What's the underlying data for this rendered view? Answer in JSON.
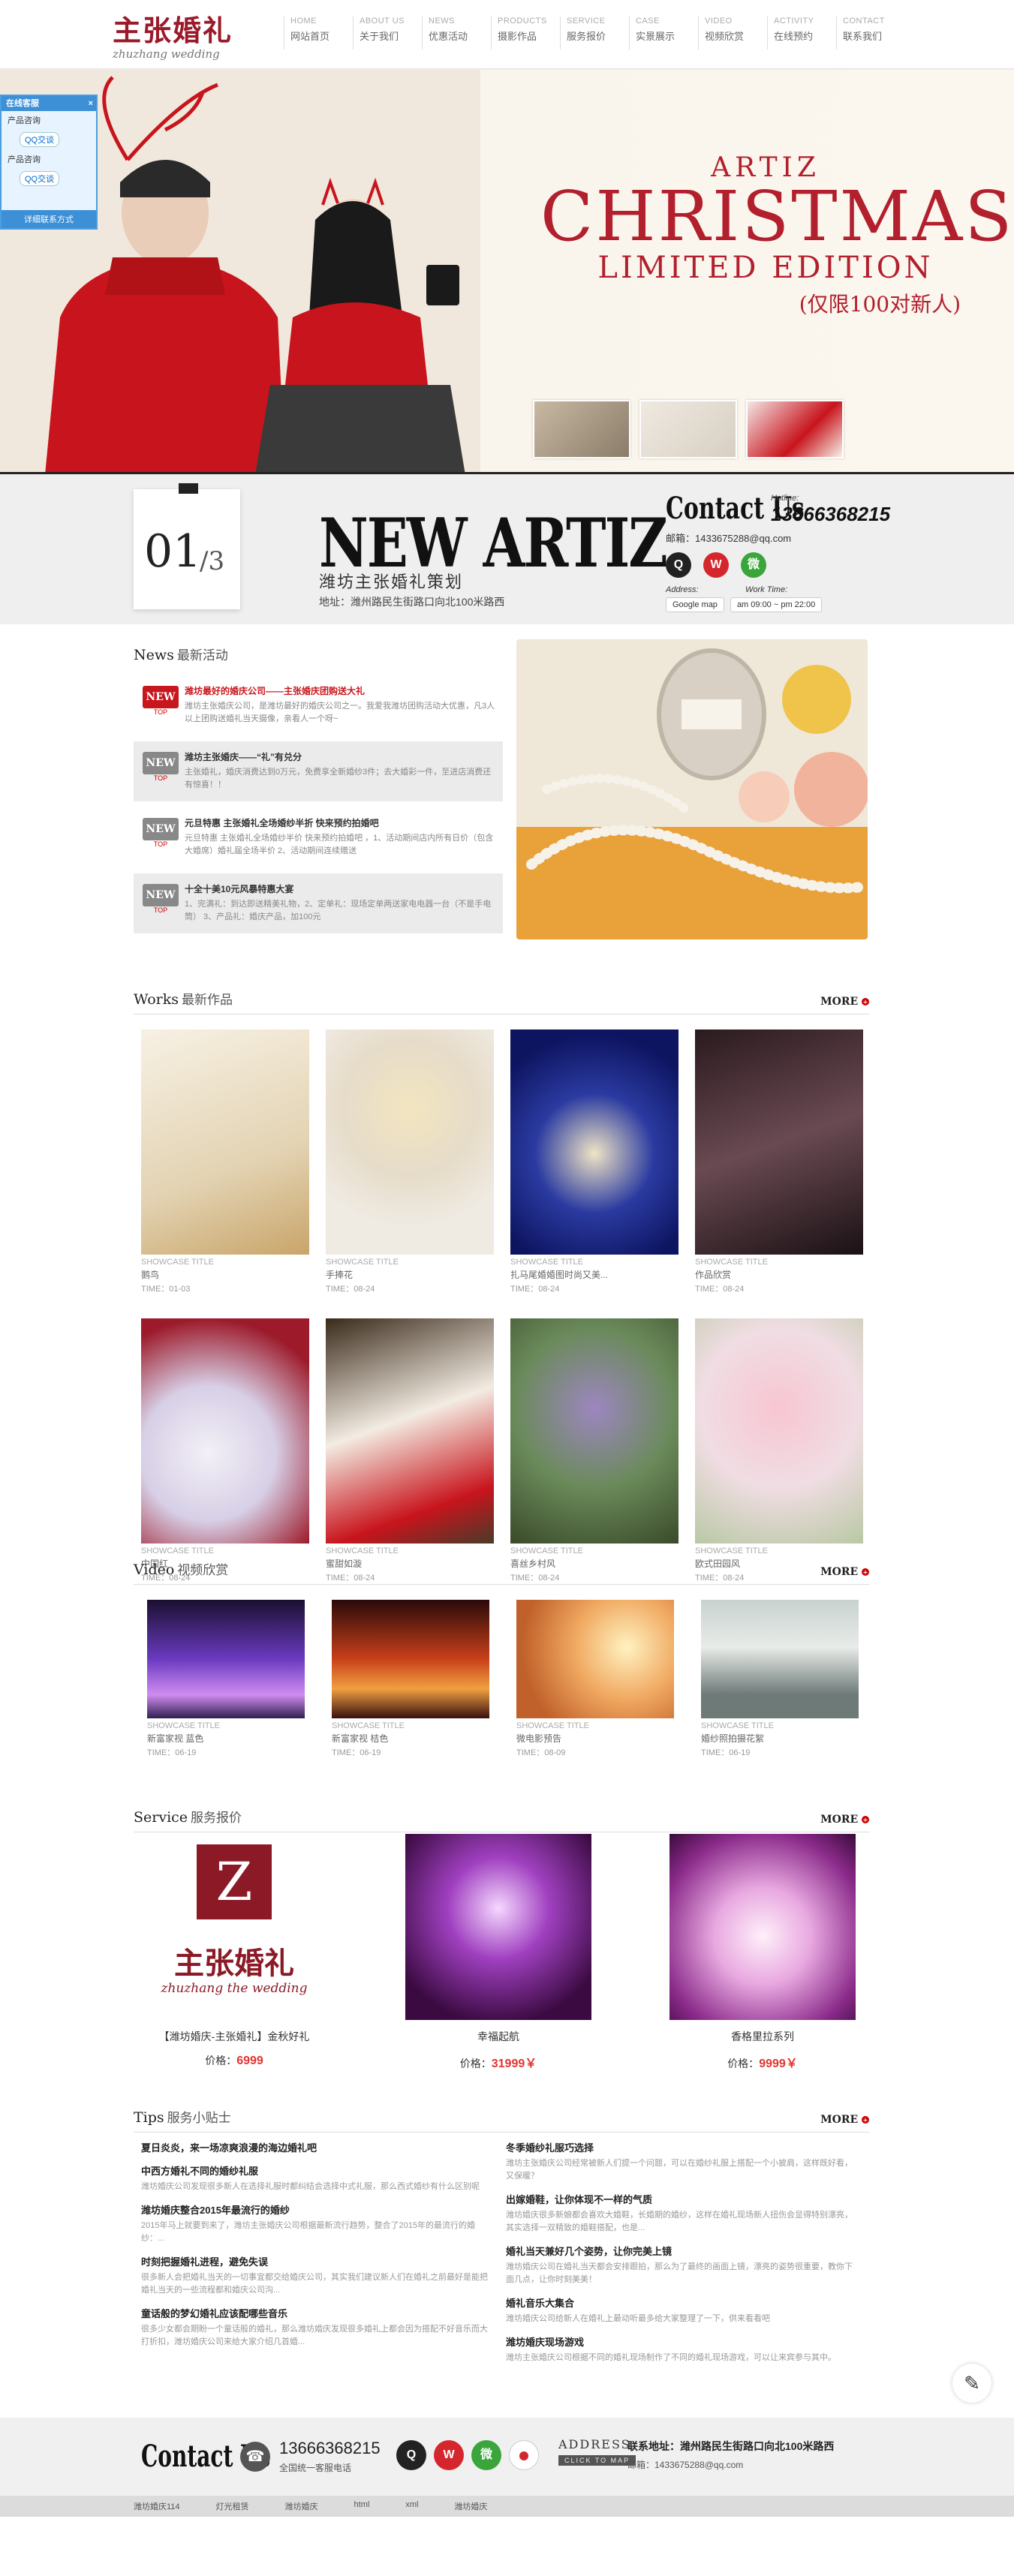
{
  "logo": {
    "main": "主张婚礼",
    "sub": "zhuzhang wedding"
  },
  "nav": [
    {
      "en": "HOME",
      "cn": "网站首页"
    },
    {
      "en": "ABOUT US",
      "cn": "关于我们"
    },
    {
      "en": "NEWS",
      "cn": "优惠活动"
    },
    {
      "en": "PRODUCTS",
      "cn": "摄影作品"
    },
    {
      "en": "SERVICE",
      "cn": "服务报价"
    },
    {
      "en": "CASE",
      "cn": "实景展示"
    },
    {
      "en": "VIDEO",
      "cn": "视频欣赏"
    },
    {
      "en": "ACTIVITY",
      "cn": "在线预约"
    },
    {
      "en": "CONTACT",
      "cn": "联系我们"
    }
  ],
  "service_widget": {
    "title": "在线客服",
    "close": "×",
    "row1_label": "产品咨询",
    "row1_btn": "QQ交谈",
    "row2_label": "产品咨询",
    "row2_btn": "QQ交谈",
    "footer": "详细联系方式"
  },
  "banner": {
    "artiz": "ARTIZ",
    "christmas": "CHRISTMAS",
    "limited": "LIMITED EDITION",
    "sub": "(仅限100对新人)"
  },
  "info": {
    "current": "01",
    "total": "/3",
    "title": "NEW ARTIZ",
    "subtitle": "潍坊主张婚礼策划",
    "address": "地址：潍州路民生街路口向北100米路西",
    "contact_title": "Contact Us",
    "hotline_label": "Hotline:",
    "hotline": "13666368215",
    "email": "邮箱：1433675288@qq.com",
    "address_label": "Address:",
    "worktime_label": "Work Time:",
    "map_btn": "Google map",
    "worktime": "am 09:00 ~ pm 22:00"
  },
  "news": {
    "title_en": "News",
    "title_cn": "最新活动",
    "items": [
      {
        "badge": "NEW",
        "badge_sub": "TOP",
        "title": "潍坊最好的婚庆公司——主张婚庆团购送大礼",
        "desc": "潍坊主张婚庆公司，是潍坊最好的婚庆公司之一。我爱我潍坊团购活动大优惠，凡3人以上团购送婚礼当天摄像，亲看人一个呀~",
        "highlight": true
      },
      {
        "badge": "NEW",
        "badge_sub": "TOP",
        "title": "潍坊主张婚庆——“礼”有兑分",
        "desc": "主张婚礼，婚庆消费达到0万元，免费享全新婚纱3件；去大婚彩一件，至进店消费还有惊喜！！",
        "highlight": false
      },
      {
        "badge": "NEW",
        "badge_sub": "TOP",
        "title": "元旦特惠 主张婚礼全场婚纱半折 快来预约拍婚吧",
        "desc": "元旦特惠 主张婚礼全场婚纱半价 快来预约拍婚吧 ，1、活动期间店内所有日价（包含大婚席）婚礼届全场半价 2、活动期间连续赠送",
        "highlight": false
      },
      {
        "badge": "NEW",
        "badge_sub": "TOP",
        "title": "十全十美10元风暴特惠大宴",
        "desc": "1、完满礼：到达即送精美礼物，2、定单礼：现场定单两送家电电器一台（不是手电筒） 3、产品礼：婚庆产品，加100元",
        "highlight": false
      }
    ]
  },
  "works": {
    "title_en": "Works",
    "title_cn": "最新作品",
    "more": "MORE",
    "caption": "SHOWCASE TITLE",
    "items": [
      {
        "name": "鹅鸟",
        "time": "TIME：01-03"
      },
      {
        "name": "手捧花",
        "time": "TIME：08-24"
      },
      {
        "name": "扎马尾婚婚图时尚又美...",
        "time": "TIME：08-24"
      },
      {
        "name": "作品欣赏",
        "time": "TIME：08-24"
      },
      {
        "name": "中国红",
        "time": "TIME：08-24"
      },
      {
        "name": "蜜甜如漩",
        "time": "TIME：08-24"
      },
      {
        "name": "喜丝乡村风",
        "time": "TIME：08-24"
      },
      {
        "name": "欧式田园风",
        "time": "TIME：08-24"
      }
    ]
  },
  "video": {
    "title_en": "Video",
    "title_cn": "视频欣赏",
    "more": "MORE",
    "caption": "SHOWCASE TITLE",
    "items": [
      {
        "name": "新富家视 蓝色",
        "time": "TIME：06-19"
      },
      {
        "name": "新富家视 桔色",
        "time": "TIME：06-19"
      },
      {
        "name": "微电影预告",
        "time": "TIME：08-09"
      },
      {
        "name": "婚纱照拍摄花絮",
        "time": "TIME：06-19"
      }
    ]
  },
  "service": {
    "title_en": "Service",
    "title_cn": "服务报价",
    "more": "MORE",
    "logo_main": "主张婚礼",
    "logo_sub": "zhuzhang the wedding",
    "items": [
      {
        "name": "【潍坊婚庆-主张婚礼】金秋好礼",
        "price_label": "价格：",
        "price": "6999"
      },
      {
        "name": "幸福起航",
        "price_label": "价格：",
        "price": "31999￥"
      },
      {
        "name": "香格里拉系列",
        "price_label": "价格：",
        "price": "9999￥"
      }
    ]
  },
  "tips": {
    "title_en": "Tips",
    "title_cn": "服务小贴士",
    "more": "MORE",
    "left": [
      {
        "title": "夏日炎炎，来一场凉爽浪漫的海边婚礼吧",
        "desc": ""
      },
      {
        "title": "中西方婚礼不同的婚纱礼服",
        "desc": "潍坊婚庆公司发现很多新人在选择礼服时都纠结会选择中式礼服，那么西式婚纱有什么区别呢"
      },
      {
        "title": "潍坊婚庆整合2015年最流行的婚纱",
        "desc": "2015年马上就要到来了，潍坊主张婚庆公司根据最新流行趋势，整合了2015年的最流行的婚纱：..."
      },
      {
        "title": "时刻把握婚礼进程，避免失误",
        "desc": "很多新人会把婚礼当天的一切事宜都交给婚庆公司，其实我们建议新人们在婚礼之前最好是能把婚礼当天的一些流程都和婚庆公司沟..."
      },
      {
        "title": "童话般的梦幻婚礼应该配哪些音乐",
        "desc": "很多少女都会期盼一个童话般的婚礼，那么潍坊婚庆发现很多婚礼上都会因为搭配不好音乐而大打折扣，潍坊婚庆公司来给大家介绍几首婚..."
      }
    ],
    "right": [
      {
        "title": "冬季婚纱礼服巧选择",
        "desc": "潍坊主张婚庆公司经常被新人们提一个问题，可以在婚纱礼服上搭配一个小披肩，这样既好看，又保暖？"
      },
      {
        "title": "出嫁婚鞋，让你体现不一样的气质",
        "desc": "潍坊婚庆很多新娘都会喜欢大婚鞋，长婚期的婚纱，这样在婚礼现场新人扭伤会显得特别漂亮，其实选择一双精致的婚鞋搭配，也是..."
      },
      {
        "title": "婚礼当天兼好几个姿势，让你完美上镜",
        "desc": "潍坊婚庆公司在婚礼当天都会安排跟拍，那么为了最终的画面上镜，漂亮的姿势很重要，教你下面几点，让你时刻美美！"
      },
      {
        "title": "婚礼音乐大集合",
        "desc": "潍坊婚庆公司给新人在婚礼上最动听最多给大家整理了一下，供来看看吧"
      },
      {
        "title": "潍坊婚庆现场游戏",
        "desc": "潍坊主张婚庆公司根据不同的婚礼现场制作了不同的婚礼现场游戏，可以让来宾参与其中。"
      }
    ]
  },
  "footer": {
    "contact_title": "Contact Us",
    "phone": "13666368215",
    "phone_label": "全国统一客服电话",
    "address_label": "ADDRESS",
    "address_sub": "CLICK TO MAP",
    "address": "联系地址：潍州路民生街路口向北100米路西",
    "email": "邮箱：1433675288@qq.com",
    "links": [
      "潍坊婚庆114",
      "灯光租赁",
      "潍坊婚庆",
      "html",
      "xml",
      "潍坊婚庆"
    ]
  },
  "colors": {
    "brand": "#b21f2d",
    "price": "#e3342f",
    "accent_blue": "#3d8fd6"
  },
  "icons": {
    "edit": "✎",
    "phone": "☎",
    "qq": "Q",
    "weibo": "W",
    "wechat": "微"
  }
}
